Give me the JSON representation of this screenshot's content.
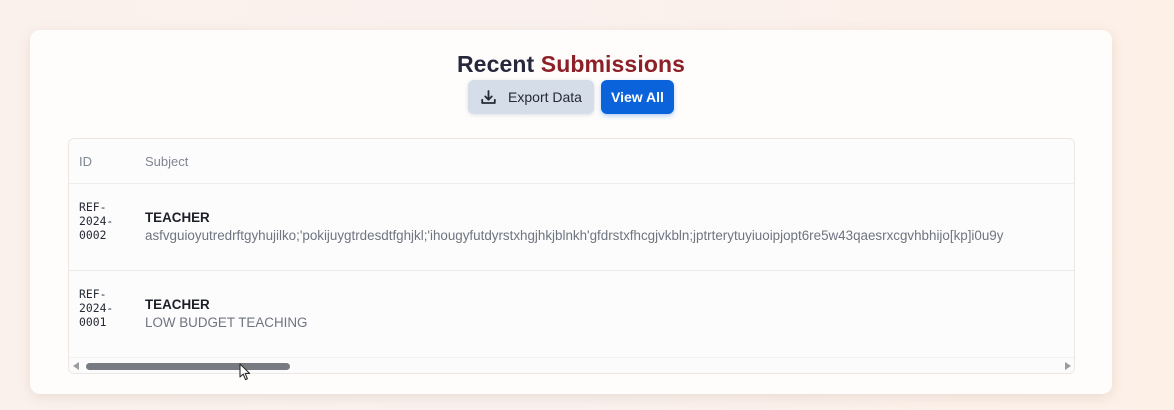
{
  "section": {
    "title_prefix": "Recent",
    "title_accent": "Submissions"
  },
  "actions": {
    "export_label": "Export Data",
    "export_icon": "download-icon",
    "view_all_label": "View All"
  },
  "table": {
    "columns": [
      "ID",
      "Subject"
    ],
    "rows": [
      {
        "id": "REF-\n2024-\n0002",
        "subject_title": "TEACHER",
        "subject_description": "asfvguioyutredrftgyhujilko;'pokijuygtrdesdtfghjkl;'ihougyfutdyrstxhgjhkjblnkh'gfdrstxfhcgjvkbln;jptrterytuyiuoipjopt6re5w43qaesrxcgvhbhijo[kp]i0u9y"
      },
      {
        "id": "REF-\n2024-\n0001",
        "subject_title": "TEACHER",
        "subject_description": "LOW BUDGET TEACHING"
      }
    ]
  },
  "scrollbar": {
    "left_icon": "scroll-left-arrow-icon",
    "right_icon": "scroll-right-arrow-icon"
  },
  "colors": {
    "accent_text": "#8d1f27",
    "primary_button": "#0b63db",
    "secondary_button": "#d4dde8"
  }
}
